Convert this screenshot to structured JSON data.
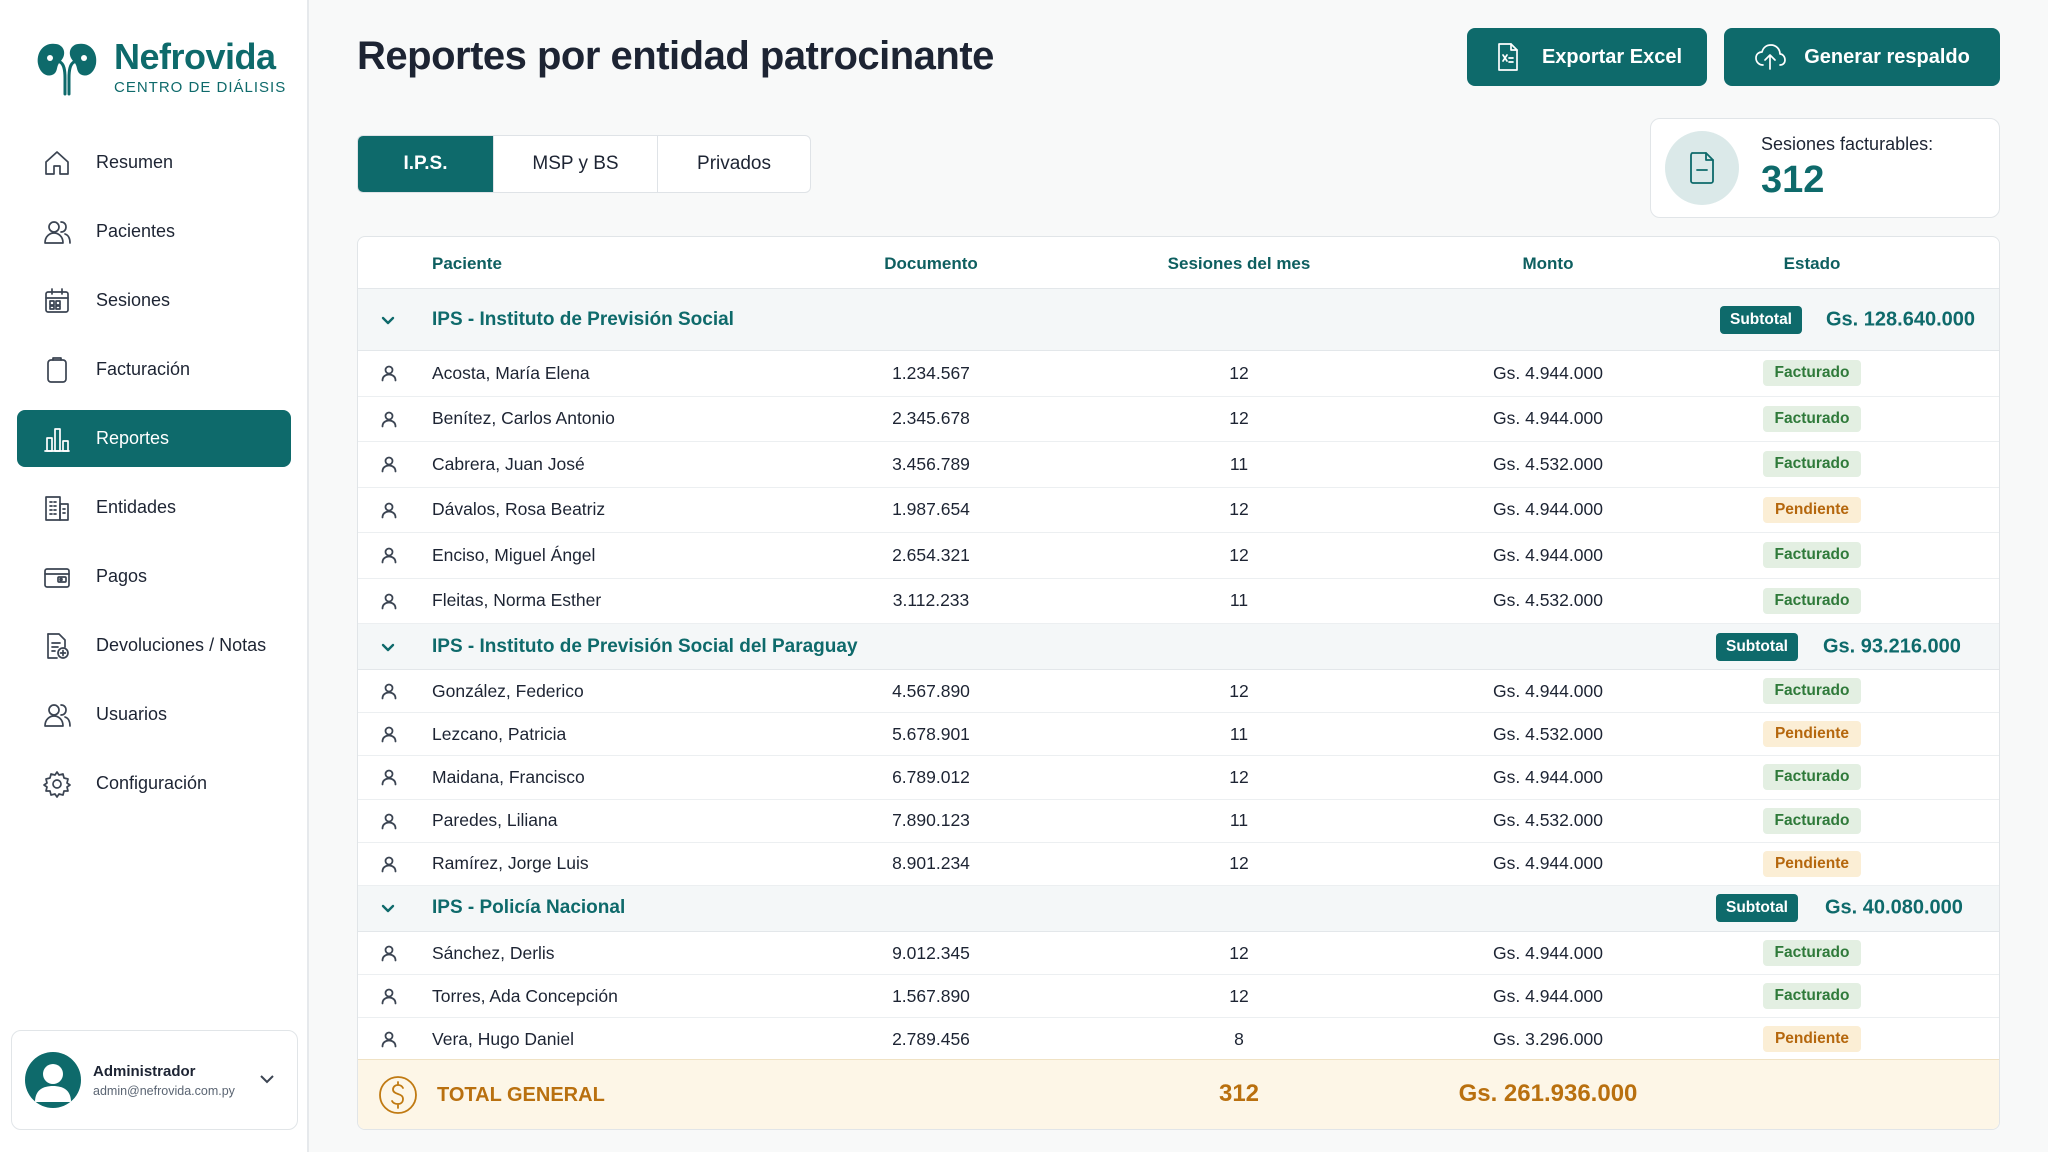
{
  "brand": {
    "name": "Nefrovida",
    "subtitle": "CENTRO DE DIÁLISIS"
  },
  "sidebar": {
    "items": [
      {
        "label": "Resumen",
        "icon": "home-icon",
        "active": false
      },
      {
        "label": "Pacientes",
        "icon": "users-icon",
        "active": false
      },
      {
        "label": "Sesiones",
        "icon": "calendar-icon",
        "active": false
      },
      {
        "label": "Facturación",
        "icon": "clipboard-icon",
        "active": false
      },
      {
        "label": "Reportes",
        "icon": "bar-chart-icon",
        "active": true
      },
      {
        "label": "Entidades",
        "icon": "building-icon",
        "active": false
      },
      {
        "label": "Pagos",
        "icon": "wallet-icon",
        "active": false
      },
      {
        "label": "Devoluciones / Notas",
        "icon": "file-plus-icon",
        "active": false
      },
      {
        "label": "Usuarios",
        "icon": "users-group-icon",
        "active": false
      },
      {
        "label": "Configuración",
        "icon": "gear-icon",
        "active": false
      }
    ]
  },
  "user": {
    "name": "Administrador",
    "email": "admin@nefrovida.com.py"
  },
  "header": {
    "title": "Reportes por entidad patrocinante",
    "export_label": "Exportar Excel",
    "backup_label": "Generar respaldo"
  },
  "tabs": [
    {
      "label": "I.P.S.",
      "active": true
    },
    {
      "label": "MSP y BS",
      "active": false
    },
    {
      "label": "Privados",
      "active": false
    }
  ],
  "kpi": {
    "label": "Sesiones facturables:",
    "value": "312"
  },
  "table": {
    "columns": [
      "Paciente",
      "Documento",
      "Sesiones del mes",
      "Monto",
      "Estado"
    ],
    "subtotal_label": "Subtotal",
    "groups": [
      {
        "name": "IPS - Instituto de Previsión Social",
        "subtotal": "Gs. 128.640.000",
        "rows": [
          {
            "patient": "Acosta, María Elena",
            "document": "1.234.567",
            "sessions": "12",
            "amount": "Gs. 4.944.000",
            "status": "Facturado"
          },
          {
            "patient": "Benítez, Carlos Antonio",
            "document": "2.345.678",
            "sessions": "12",
            "amount": "Gs. 4.944.000",
            "status": "Facturado"
          },
          {
            "patient": "Cabrera, Juan José",
            "document": "3.456.789",
            "sessions": "11",
            "amount": "Gs. 4.532.000",
            "status": "Facturado"
          },
          {
            "patient": "Dávalos, Rosa Beatriz",
            "document": "1.987.654",
            "sessions": "12",
            "amount": "Gs. 4.944.000",
            "status": "Pendiente"
          },
          {
            "patient": "Enciso, Miguel Ángel",
            "document": "2.654.321",
            "sessions": "12",
            "amount": "Gs. 4.944.000",
            "status": "Facturado"
          },
          {
            "patient": "Fleitas, Norma Esther",
            "document": "3.112.233",
            "sessions": "11",
            "amount": "Gs. 4.532.000",
            "status": "Facturado"
          }
        ]
      },
      {
        "name": "IPS - Instituto de Previsión Social del Paraguay",
        "subtotal": "Gs. 93.216.000",
        "rows": [
          {
            "patient": "González, Federico",
            "document": "4.567.890",
            "sessions": "12",
            "amount": "Gs. 4.944.000",
            "status": "Facturado"
          },
          {
            "patient": "Lezcano, Patricia",
            "document": "5.678.901",
            "sessions": "11",
            "amount": "Gs. 4.532.000",
            "status": "Pendiente"
          },
          {
            "patient": "Maidana, Francisco",
            "document": "6.789.012",
            "sessions": "12",
            "amount": "Gs. 4.944.000",
            "status": "Facturado"
          },
          {
            "patient": "Paredes, Liliana",
            "document": "7.890.123",
            "sessions": "11",
            "amount": "Gs. 4.532.000",
            "status": "Facturado"
          },
          {
            "patient": "Ramírez, Jorge Luis",
            "document": "8.901.234",
            "sessions": "12",
            "amount": "Gs. 4.944.000",
            "status": "Pendiente"
          }
        ]
      },
      {
        "name": "IPS - Policía Nacional",
        "subtotal": "Gs. 40.080.000",
        "rows": [
          {
            "patient": "Sánchez, Derlis",
            "document": "9.012.345",
            "sessions": "12",
            "amount": "Gs. 4.944.000",
            "status": "Facturado"
          },
          {
            "patient": "Torres, Ada Concepción",
            "document": "1.567.890",
            "sessions": "12",
            "amount": "Gs. 4.944.000",
            "status": "Facturado"
          },
          {
            "patient": "Vera, Hugo Daniel",
            "document": "2.789.456",
            "sessions": "8",
            "amount": "Gs. 3.296.000",
            "status": "Pendiente"
          }
        ]
      }
    ],
    "total": {
      "label": "TOTAL GENERAL",
      "sessions": "312",
      "amount": "Gs. 261.936.000"
    }
  },
  "colors": {
    "primary": "#0e6a6b",
    "accent_gold": "#b9700f",
    "status_ok_bg": "#e3efe2",
    "status_pending_bg": "#fbeed5"
  }
}
